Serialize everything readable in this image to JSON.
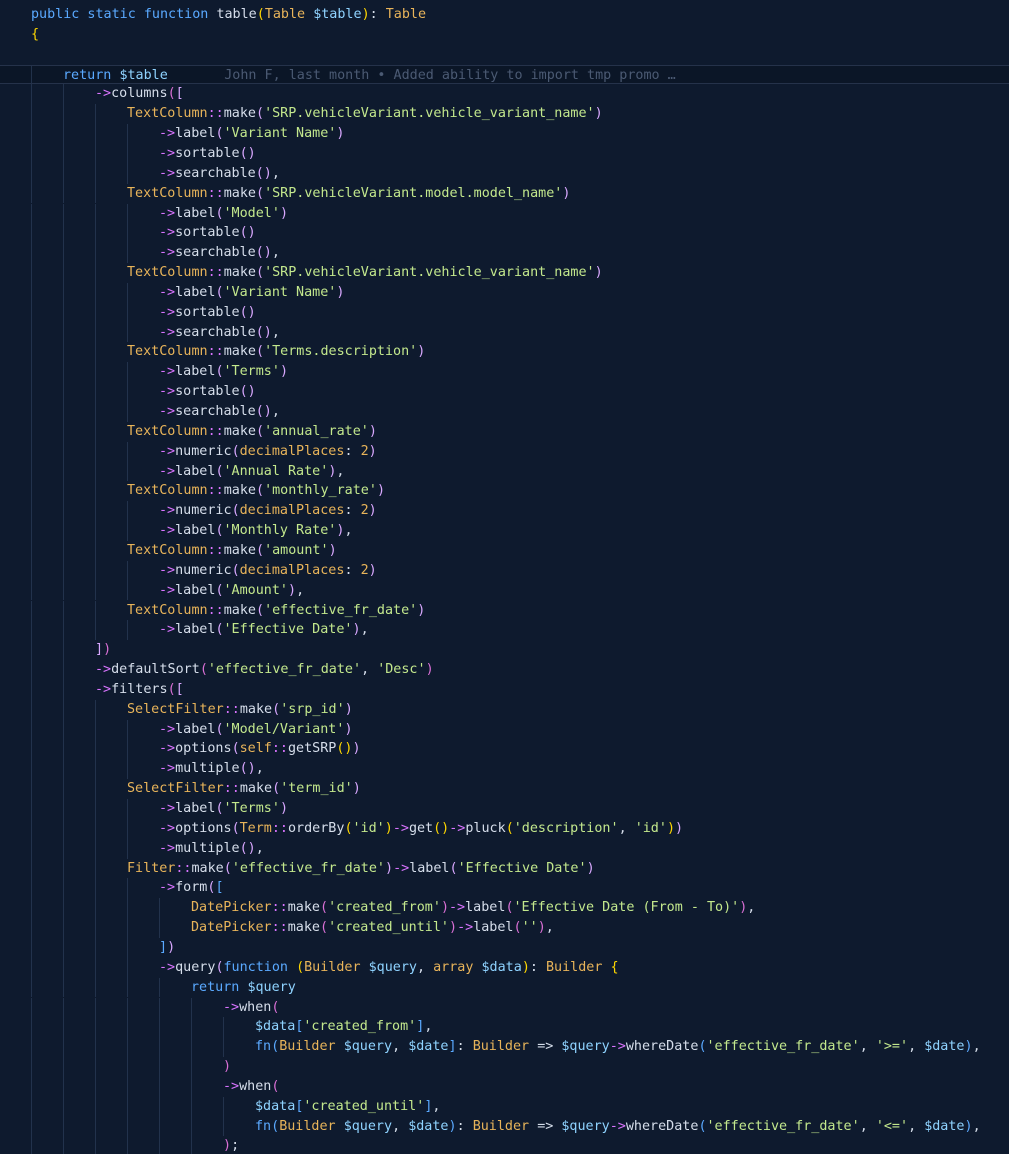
{
  "editor": {
    "theme_colors": {
      "background": "#0e1a2e",
      "keyword": "#5aa9ff",
      "type": "#e8b45a",
      "variable": "#8fd3ff",
      "string": "#c3e88d",
      "arrow": "#d974ff",
      "bracket_yellow": "#ffd700",
      "bracket_magenta": "#da70d6",
      "blame": "#4b5a73"
    },
    "git_blame": "John F, last month • Added ability to import tmp promo …",
    "lines": [
      [
        [
          "k",
          "public static function "
        ],
        [
          "f",
          "table"
        ],
        [
          "y",
          "("
        ],
        [
          "t",
          "Table "
        ],
        [
          "v",
          "$table"
        ],
        [
          "y",
          ")"
        ],
        [
          "p",
          ": "
        ],
        [
          "t",
          "Table"
        ]
      ],
      [
        [
          "y",
          "{"
        ]
      ],
      [],
      [
        [
          "k",
          "return "
        ],
        [
          "v",
          "$table"
        ]
      ],
      [
        [
          "a",
          "->"
        ],
        [
          "f",
          "columns"
        ],
        [
          "m",
          "("
        ],
        [
          "c",
          "["
        ]
      ],
      [
        [
          "t",
          "TextColumn"
        ],
        [
          "a",
          "::"
        ],
        [
          "f",
          "make"
        ],
        [
          "c",
          "("
        ],
        [
          "s",
          "'SRP.vehicleVariant.vehicle_variant_name'"
        ],
        [
          "c",
          ")"
        ]
      ],
      [
        [
          "a",
          "->"
        ],
        [
          "f",
          "label"
        ],
        [
          "c",
          "("
        ],
        [
          "s",
          "'Variant Name'"
        ],
        [
          "c",
          ")"
        ]
      ],
      [
        [
          "a",
          "->"
        ],
        [
          "f",
          "sortable"
        ],
        [
          "c",
          "()"
        ]
      ],
      [
        [
          "a",
          "->"
        ],
        [
          "f",
          "searchable"
        ],
        [
          "c",
          "()"
        ],
        [
          "p",
          ","
        ]
      ],
      [
        [
          "t",
          "TextColumn"
        ],
        [
          "a",
          "::"
        ],
        [
          "f",
          "make"
        ],
        [
          "c",
          "("
        ],
        [
          "s",
          "'SRP.vehicleVariant.model.model_name'"
        ],
        [
          "c",
          ")"
        ]
      ],
      [
        [
          "a",
          "->"
        ],
        [
          "f",
          "label"
        ],
        [
          "c",
          "("
        ],
        [
          "s",
          "'Model'"
        ],
        [
          "c",
          ")"
        ]
      ],
      [
        [
          "a",
          "->"
        ],
        [
          "f",
          "sortable"
        ],
        [
          "c",
          "()"
        ]
      ],
      [
        [
          "a",
          "->"
        ],
        [
          "f",
          "searchable"
        ],
        [
          "c",
          "()"
        ],
        [
          "p",
          ","
        ]
      ],
      [
        [
          "t",
          "TextColumn"
        ],
        [
          "a",
          "::"
        ],
        [
          "f",
          "make"
        ],
        [
          "c",
          "("
        ],
        [
          "s",
          "'SRP.vehicleVariant.vehicle_variant_name'"
        ],
        [
          "c",
          ")"
        ]
      ],
      [
        [
          "a",
          "->"
        ],
        [
          "f",
          "label"
        ],
        [
          "c",
          "("
        ],
        [
          "s",
          "'Variant Name'"
        ],
        [
          "c",
          ")"
        ]
      ],
      [
        [
          "a",
          "->"
        ],
        [
          "f",
          "sortable"
        ],
        [
          "c",
          "()"
        ]
      ],
      [
        [
          "a",
          "->"
        ],
        [
          "f",
          "searchable"
        ],
        [
          "c",
          "()"
        ],
        [
          "p",
          ","
        ]
      ],
      [
        [
          "t",
          "TextColumn"
        ],
        [
          "a",
          "::"
        ],
        [
          "f",
          "make"
        ],
        [
          "c",
          "("
        ],
        [
          "s",
          "'Terms.description'"
        ],
        [
          "c",
          ")"
        ]
      ],
      [
        [
          "a",
          "->"
        ],
        [
          "f",
          "label"
        ],
        [
          "c",
          "("
        ],
        [
          "s",
          "'Terms'"
        ],
        [
          "c",
          ")"
        ]
      ],
      [
        [
          "a",
          "->"
        ],
        [
          "f",
          "sortable"
        ],
        [
          "c",
          "()"
        ]
      ],
      [
        [
          "a",
          "->"
        ],
        [
          "f",
          "searchable"
        ],
        [
          "c",
          "()"
        ],
        [
          "p",
          ","
        ]
      ],
      [
        [
          "t",
          "TextColumn"
        ],
        [
          "a",
          "::"
        ],
        [
          "f",
          "make"
        ],
        [
          "c",
          "("
        ],
        [
          "s",
          "'annual_rate'"
        ],
        [
          "c",
          ")"
        ]
      ],
      [
        [
          "a",
          "->"
        ],
        [
          "f",
          "numeric"
        ],
        [
          "c",
          "("
        ],
        [
          "n",
          "decimalPlaces"
        ],
        [
          "p",
          ": "
        ],
        [
          "n",
          "2"
        ],
        [
          "c",
          ")"
        ]
      ],
      [
        [
          "a",
          "->"
        ],
        [
          "f",
          "label"
        ],
        [
          "c",
          "("
        ],
        [
          "s",
          "'Annual Rate'"
        ],
        [
          "c",
          ")"
        ],
        [
          "p",
          ","
        ]
      ],
      [
        [
          "t",
          "TextColumn"
        ],
        [
          "a",
          "::"
        ],
        [
          "f",
          "make"
        ],
        [
          "c",
          "("
        ],
        [
          "s",
          "'monthly_rate'"
        ],
        [
          "c",
          ")"
        ]
      ],
      [
        [
          "a",
          "->"
        ],
        [
          "f",
          "numeric"
        ],
        [
          "c",
          "("
        ],
        [
          "n",
          "decimalPlaces"
        ],
        [
          "p",
          ": "
        ],
        [
          "n",
          "2"
        ],
        [
          "c",
          ")"
        ]
      ],
      [
        [
          "a",
          "->"
        ],
        [
          "f",
          "label"
        ],
        [
          "c",
          "("
        ],
        [
          "s",
          "'Monthly Rate'"
        ],
        [
          "c",
          ")"
        ],
        [
          "p",
          ","
        ]
      ],
      [
        [
          "t",
          "TextColumn"
        ],
        [
          "a",
          "::"
        ],
        [
          "f",
          "make"
        ],
        [
          "c",
          "("
        ],
        [
          "s",
          "'amount'"
        ],
        [
          "c",
          ")"
        ]
      ],
      [
        [
          "a",
          "->"
        ],
        [
          "f",
          "numeric"
        ],
        [
          "c",
          "("
        ],
        [
          "n",
          "decimalPlaces"
        ],
        [
          "p",
          ": "
        ],
        [
          "n",
          "2"
        ],
        [
          "c",
          ")"
        ]
      ],
      [
        [
          "a",
          "->"
        ],
        [
          "f",
          "label"
        ],
        [
          "c",
          "("
        ],
        [
          "s",
          "'Amount'"
        ],
        [
          "c",
          ")"
        ],
        [
          "p",
          ","
        ]
      ],
      [
        [
          "t",
          "TextColumn"
        ],
        [
          "a",
          "::"
        ],
        [
          "f",
          "make"
        ],
        [
          "c",
          "("
        ],
        [
          "s",
          "'effective_fr_date'"
        ],
        [
          "c",
          ")"
        ]
      ],
      [
        [
          "a",
          "->"
        ],
        [
          "f",
          "label"
        ],
        [
          "c",
          "("
        ],
        [
          "s",
          "'Effective Date'"
        ],
        [
          "c",
          ")"
        ],
        [
          "p",
          ","
        ]
      ],
      [
        [
          "c",
          "]"
        ],
        [
          "m",
          ")"
        ]
      ],
      [
        [
          "a",
          "->"
        ],
        [
          "f",
          "defaultSort"
        ],
        [
          "m",
          "("
        ],
        [
          "s",
          "'effective_fr_date'"
        ],
        [
          "p",
          ", "
        ],
        [
          "s",
          "'Desc'"
        ],
        [
          "m",
          ")"
        ]
      ],
      [
        [
          "a",
          "->"
        ],
        [
          "f",
          "filters"
        ],
        [
          "m",
          "("
        ],
        [
          "c",
          "["
        ]
      ],
      [
        [
          "t",
          "SelectFilter"
        ],
        [
          "a",
          "::"
        ],
        [
          "f",
          "make"
        ],
        [
          "c",
          "("
        ],
        [
          "s",
          "'srp_id'"
        ],
        [
          "c",
          ")"
        ]
      ],
      [
        [
          "a",
          "->"
        ],
        [
          "f",
          "label"
        ],
        [
          "c",
          "("
        ],
        [
          "s",
          "'Model/Variant'"
        ],
        [
          "c",
          ")"
        ]
      ],
      [
        [
          "a",
          "->"
        ],
        [
          "f",
          "options"
        ],
        [
          "c",
          "("
        ],
        [
          "t",
          "self"
        ],
        [
          "a",
          "::"
        ],
        [
          "f",
          "getSRP"
        ],
        [
          "y",
          "()"
        ],
        [
          "c",
          ")"
        ]
      ],
      [
        [
          "a",
          "->"
        ],
        [
          "f",
          "multiple"
        ],
        [
          "c",
          "()"
        ],
        [
          "p",
          ","
        ]
      ],
      [
        [
          "t",
          "SelectFilter"
        ],
        [
          "a",
          "::"
        ],
        [
          "f",
          "make"
        ],
        [
          "c",
          "("
        ],
        [
          "s",
          "'term_id'"
        ],
        [
          "c",
          ")"
        ]
      ],
      [
        [
          "a",
          "->"
        ],
        [
          "f",
          "label"
        ],
        [
          "c",
          "("
        ],
        [
          "s",
          "'Terms'"
        ],
        [
          "c",
          ")"
        ]
      ],
      [
        [
          "a",
          "->"
        ],
        [
          "f",
          "options"
        ],
        [
          "c",
          "("
        ],
        [
          "t",
          "Term"
        ],
        [
          "a",
          "::"
        ],
        [
          "f",
          "orderBy"
        ],
        [
          "y",
          "("
        ],
        [
          "s",
          "'id'"
        ],
        [
          "y",
          ")"
        ],
        [
          "a",
          "->"
        ],
        [
          "f",
          "get"
        ],
        [
          "y",
          "()"
        ],
        [
          "a",
          "->"
        ],
        [
          "f",
          "pluck"
        ],
        [
          "y",
          "("
        ],
        [
          "s",
          "'description'"
        ],
        [
          "p",
          ", "
        ],
        [
          "s",
          "'id'"
        ],
        [
          "y",
          ")"
        ],
        [
          "c",
          ")"
        ]
      ],
      [
        [
          "a",
          "->"
        ],
        [
          "f",
          "multiple"
        ],
        [
          "c",
          "()"
        ],
        [
          "p",
          ","
        ]
      ],
      [
        [
          "t",
          "Filter"
        ],
        [
          "a",
          "::"
        ],
        [
          "f",
          "make"
        ],
        [
          "c",
          "("
        ],
        [
          "s",
          "'effective_fr_date'"
        ],
        [
          "c",
          ")"
        ],
        [
          "a",
          "->"
        ],
        [
          "f",
          "label"
        ],
        [
          "c",
          "("
        ],
        [
          "s",
          "'Effective Date'"
        ],
        [
          "c",
          ")"
        ]
      ],
      [
        [
          "a",
          "->"
        ],
        [
          "f",
          "form"
        ],
        [
          "c",
          "("
        ],
        [
          "k",
          "["
        ]
      ],
      [
        [
          "t",
          "DatePicker"
        ],
        [
          "a",
          "::"
        ],
        [
          "f",
          "make"
        ],
        [
          "m",
          "("
        ],
        [
          "s",
          "'created_from'"
        ],
        [
          "m",
          ")"
        ],
        [
          "a",
          "->"
        ],
        [
          "f",
          "label"
        ],
        [
          "m",
          "("
        ],
        [
          "s",
          "'Effective Date (From - To)'"
        ],
        [
          "m",
          ")"
        ],
        [
          "p",
          ","
        ]
      ],
      [
        [
          "t",
          "DatePicker"
        ],
        [
          "a",
          "::"
        ],
        [
          "f",
          "make"
        ],
        [
          "m",
          "("
        ],
        [
          "s",
          "'created_until'"
        ],
        [
          "m",
          ")"
        ],
        [
          "a",
          "->"
        ],
        [
          "f",
          "label"
        ],
        [
          "m",
          "("
        ],
        [
          "s",
          "''"
        ],
        [
          "m",
          ")"
        ],
        [
          "p",
          ","
        ]
      ],
      [
        [
          "k",
          "]"
        ],
        [
          "c",
          ")"
        ]
      ],
      [
        [
          "a",
          "->"
        ],
        [
          "f",
          "query"
        ],
        [
          "c",
          "("
        ],
        [
          "k",
          "function "
        ],
        [
          "y",
          "("
        ],
        [
          "t",
          "Builder "
        ],
        [
          "v",
          "$query"
        ],
        [
          "p",
          ", "
        ],
        [
          "t",
          "array "
        ],
        [
          "v",
          "$data"
        ],
        [
          "y",
          ")"
        ],
        [
          "p",
          ": "
        ],
        [
          "t",
          "Builder "
        ],
        [
          "y",
          "{"
        ]
      ],
      [
        [
          "k",
          "return "
        ],
        [
          "v",
          "$query"
        ]
      ],
      [
        [
          "a",
          "->"
        ],
        [
          "f",
          "when"
        ],
        [
          "m",
          "("
        ]
      ],
      [
        [
          "v",
          "$data"
        ],
        [
          "k",
          "["
        ],
        [
          "s",
          "'created_from'"
        ],
        [
          "k",
          "]"
        ],
        [
          "p",
          ","
        ]
      ],
      [
        [
          "k",
          "fn"
        ],
        [
          "k",
          "("
        ],
        [
          "t",
          "Builder "
        ],
        [
          "v",
          "$query"
        ],
        [
          "p",
          ", "
        ],
        [
          "v",
          "$date"
        ],
        [
          "k",
          "]"
        ],
        [
          "p",
          ": "
        ],
        [
          "t",
          "Builder "
        ],
        [
          "p",
          "=> "
        ],
        [
          "v",
          "$query"
        ],
        [
          "a",
          "->"
        ],
        [
          "f",
          "whereDate"
        ],
        [
          "k",
          "("
        ],
        [
          "s",
          "'effective_fr_date'"
        ],
        [
          "p",
          ", "
        ],
        [
          "s",
          "'>='"
        ],
        [
          "p",
          ", "
        ],
        [
          "v",
          "$date"
        ],
        [
          "k",
          ")"
        ],
        [
          "p",
          ","
        ]
      ],
      [
        [
          "m",
          ")"
        ]
      ],
      [
        [
          "a",
          "->"
        ],
        [
          "f",
          "when"
        ],
        [
          "m",
          "("
        ]
      ],
      [
        [
          "v",
          "$data"
        ],
        [
          "k",
          "["
        ],
        [
          "s",
          "'created_until'"
        ],
        [
          "k",
          "]"
        ],
        [
          "p",
          ","
        ]
      ],
      [
        [
          "k",
          "fn"
        ],
        [
          "k",
          "("
        ],
        [
          "t",
          "Builder "
        ],
        [
          "v",
          "$query"
        ],
        [
          "p",
          ", "
        ],
        [
          "v",
          "$date"
        ],
        [
          "k",
          ")"
        ],
        [
          "p",
          ": "
        ],
        [
          "t",
          "Builder "
        ],
        [
          "p",
          "=> "
        ],
        [
          "v",
          "$query"
        ],
        [
          "a",
          "->"
        ],
        [
          "f",
          "whereDate"
        ],
        [
          "k",
          "("
        ],
        [
          "s",
          "'effective_fr_date'"
        ],
        [
          "p",
          ", "
        ],
        [
          "s",
          "'<='"
        ],
        [
          "p",
          ", "
        ],
        [
          "v",
          "$date"
        ],
        [
          "k",
          ")"
        ],
        [
          "p",
          ","
        ]
      ],
      [
        [
          "m",
          ")"
        ],
        [
          "p",
          ";"
        ]
      ]
    ]
  }
}
